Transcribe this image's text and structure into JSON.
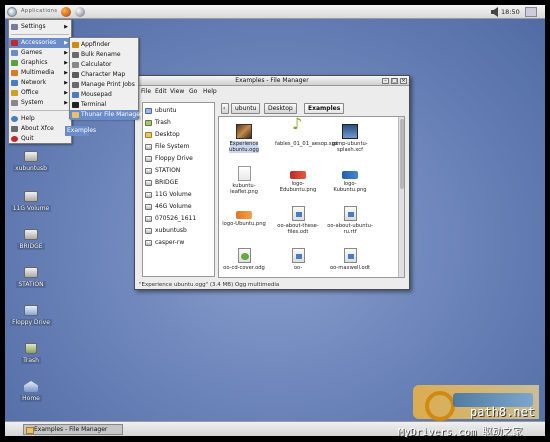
{
  "top_panel": {
    "tasks_label": "Applications",
    "clock": "18:50"
  },
  "app_menu": {
    "items": [
      {
        "label": "Settings",
        "has_submenu": true,
        "color": "#7a7a9a"
      },
      {
        "label": "Accessories",
        "has_submenu": true,
        "active": true,
        "color": "#c0282d"
      },
      {
        "label": "Games",
        "has_submenu": true,
        "color": "#6a8cc8"
      },
      {
        "label": "Graphics",
        "has_submenu": true,
        "color": "#5aa040"
      },
      {
        "label": "Multimedia",
        "has_submenu": true,
        "color": "#e07a20"
      },
      {
        "label": "Network",
        "has_submenu": true,
        "color": "#4a7cc0"
      },
      {
        "label": "Office",
        "has_submenu": true,
        "color": "#d0a020"
      },
      {
        "label": "System",
        "has_submenu": true,
        "color": "#888888"
      },
      {
        "label": "Help",
        "has_submenu": false,
        "color": "#4a7cc0"
      },
      {
        "label": "About Xfce",
        "has_submenu": false,
        "color": "#6a6a6a"
      },
      {
        "label": "Quit",
        "has_submenu": false,
        "color": "#c0282d"
      }
    ]
  },
  "accessories_submenu": {
    "items": [
      {
        "label": "Appfinder",
        "color": "#d08a12"
      },
      {
        "label": "Bulk Rename",
        "color": "#6a6a6a"
      },
      {
        "label": "Calculator",
        "color": "#888888"
      },
      {
        "label": "Character Map",
        "color": "#5a5a5a"
      },
      {
        "label": "Manage Print Jobs",
        "color": "#6a6a6a"
      },
      {
        "label": "Mousepad",
        "color": "#4a7cc0"
      },
      {
        "label": "Terminal",
        "color": "#222222"
      },
      {
        "label": "Thunar File Manager",
        "color": "#e8c36a",
        "active": true
      }
    ]
  },
  "tooltip": "Examples",
  "desktop_icons": [
    {
      "label": "xubuntusb",
      "kind": "drive"
    },
    {
      "label": "11G Volume",
      "kind": "drive"
    },
    {
      "label": "BRIDGE",
      "kind": "drive"
    },
    {
      "label": "STATION",
      "kind": "drive"
    },
    {
      "label": "Floppy Drive",
      "kind": "monitor"
    },
    {
      "label": "Trash",
      "kind": "trash"
    },
    {
      "label": "Home",
      "kind": "home"
    }
  ],
  "file_manager": {
    "title": "Examples - File Manager",
    "menubar": [
      "File",
      "Edit",
      "View",
      "Go",
      "Help"
    ],
    "sidebar": [
      {
        "label": "ubuntu",
        "kind": "blue"
      },
      {
        "label": "Trash",
        "kind": "trash"
      },
      {
        "label": "Desktop",
        "kind": "folder"
      },
      {
        "label": "File System",
        "kind": "drive"
      },
      {
        "label": "Floppy Drive",
        "kind": "drive"
      },
      {
        "label": "STATION",
        "kind": "drive"
      },
      {
        "label": "BRIDGE",
        "kind": "drive"
      },
      {
        "label": "11G Volume",
        "kind": "drive"
      },
      {
        "label": "46G Volume",
        "kind": "drive"
      },
      {
        "label": "070526_1611",
        "kind": "drive"
      },
      {
        "label": "xubuntusb",
        "kind": "drive"
      },
      {
        "label": "casper-rw",
        "kind": "drive"
      }
    ],
    "pathbar": [
      "ubuntu",
      "Desktop",
      "Examples"
    ],
    "files": [
      {
        "label": "Experience ubuntu.ogg",
        "thumb": "photo",
        "selected": true
      },
      {
        "label": "fables_01_01_aesop.spx",
        "thumb": "music"
      },
      {
        "label": "gimp-ubuntu-splash.xcf",
        "thumb": "screen"
      },
      {
        "label": "kubuntu-leaflet.png",
        "thumb": "doc"
      },
      {
        "label": "logo-Edubuntu.png",
        "thumb": "logo-red"
      },
      {
        "label": "logo-Kubuntu.png",
        "thumb": "logo-blue"
      },
      {
        "label": "logo-Ubuntu.png",
        "thumb": "logo-orange"
      },
      {
        "label": "oo-about-these-files.odt",
        "thumb": "odt"
      },
      {
        "label": "oo-about-ubuntu-ru.rtf",
        "thumb": "odt"
      },
      {
        "label": "oo-cd-cover.odg",
        "thumb": "odg"
      },
      {
        "label": "oo-",
        "thumb": "odt"
      },
      {
        "label": "oo-maxwell.odt",
        "thumb": "odt"
      }
    ],
    "status": "\"Experience ubuntu.ogg\" (3.4 MB) Ogg multimedia"
  },
  "taskbar": {
    "button_label": "Examples - File Manager"
  },
  "watermark": {
    "site": "path8.net",
    "mydrivers": "MyDrivers.com 驱动之家"
  }
}
